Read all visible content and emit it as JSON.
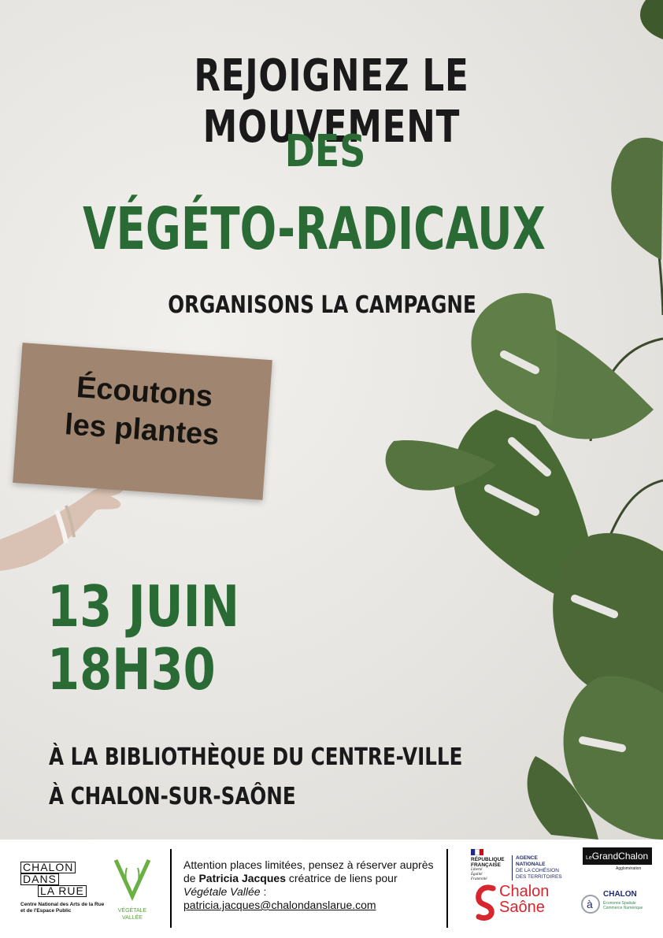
{
  "headline": {
    "line1": "REJOIGNEZ LE MOUVEMENT",
    "line2": "DES",
    "line3": "VÉGÉTO-RADICAUX",
    "line4": "ORGANISONS LA CAMPAGNE"
  },
  "sign": {
    "line1": "Écoutons",
    "line2": "les plantes"
  },
  "event": {
    "date": "13 JUIN",
    "time": "18H30",
    "venue_line1": "À LA BIBLIOTHÈQUE DU CENTRE-VILLE",
    "venue_line2": "À CHALON-SUR-SAÔNE"
  },
  "footer": {
    "chalon_logo": {
      "mark_lines": [
        "CHALON",
        "DANS",
        "LA RUE"
      ],
      "subtitle_line1": "Centre National des Arts de la Rue",
      "subtitle_line2": "et de l'Espace Public"
    },
    "vegetale_logo": {
      "line1": "VÉGÉTALE",
      "line2": "VALLÉE"
    },
    "info": {
      "text1": "Attention places limitées, pensez à réserver auprès de ",
      "name": "Patricia Jacques",
      "text2": " créatrice de liens pour ",
      "brand": "Végétale Vallée",
      "text3": " :",
      "email": "patricia.jacques@chalondanslarue.com"
    },
    "republique": {
      "line1": "RÉPUBLIQUE",
      "line2": "FRANÇAISE",
      "motto1": "Liberté",
      "motto2": "Égalité",
      "motto3": "Fraternité"
    },
    "anct": {
      "line1": "AGENCE",
      "line2": "NATIONALE",
      "line3": "DE LA COHÉSION",
      "line4": "DES TERRITOIRES"
    },
    "chalon_sur_saone": {
      "line1": "Chalon",
      "line2": "Saône",
      "sur": "sur"
    },
    "grand_chalon": {
      "name": "GrandChalon",
      "prefix": "Le",
      "sub": "Agglomération"
    },
    "a_chalon": {
      "name": "CHALON",
      "sub1": "Économie Spatiale",
      "sub2": "Commerce Numérique"
    }
  }
}
